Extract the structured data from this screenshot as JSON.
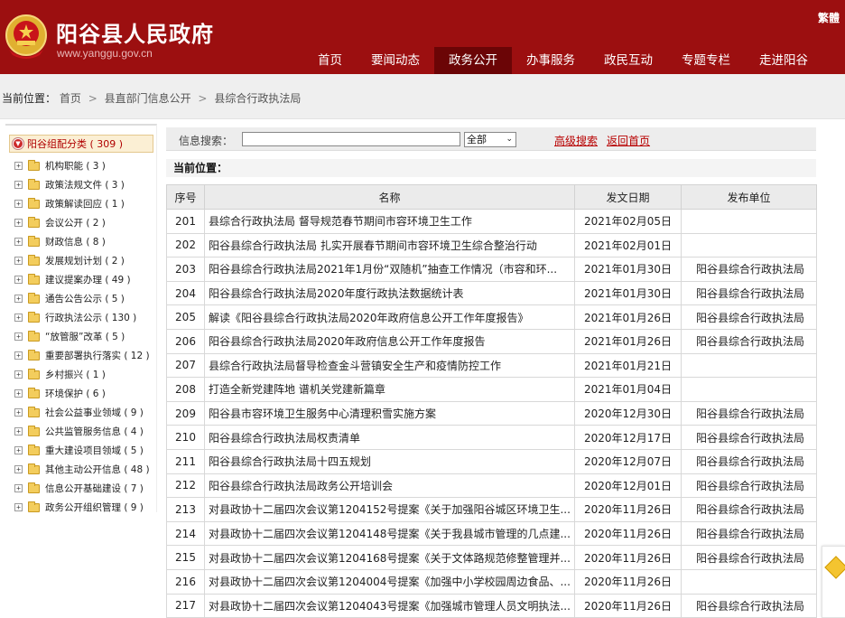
{
  "header": {
    "title": "阳谷县人民政府",
    "url": "www.yanggu.gov.cn",
    "trad_link": "繁體"
  },
  "nav": [
    {
      "label": "首页",
      "active": false
    },
    {
      "label": "要闻动态",
      "active": false
    },
    {
      "label": "政务公开",
      "active": true
    },
    {
      "label": "办事服务",
      "active": false
    },
    {
      "label": "政民互动",
      "active": false
    },
    {
      "label": "专题专栏",
      "active": false
    },
    {
      "label": "走进阳谷",
      "active": false
    }
  ],
  "breadcrumb": {
    "label": "当前位置：",
    "items": [
      "首页",
      "县直部门信息公开",
      "县综合行政执法局"
    ],
    "sep": ">"
  },
  "sidebar": {
    "root": "阳谷组配分类 ( 309 )",
    "items": [
      "机构职能 ( 3 )",
      "政策法规文件 ( 3 )",
      "政策解读回应 ( 1 )",
      "会议公开 ( 2 )",
      "财政信息 ( 8 )",
      "发展规划计划 ( 2 )",
      "建议提案办理 ( 49 )",
      "通告公告公示 ( 5 )",
      "行政执法公示 ( 130 )",
      "“放管服”改革 ( 5 )",
      "重要部署执行落实 ( 12 )",
      "乡村振兴 ( 1 )",
      "环境保护 ( 6 )",
      "社会公益事业领域 ( 9 )",
      "公共监管服务信息 ( 4 )",
      "重大建设项目领域 ( 5 )",
      "其他主动公开信息 ( 48 )",
      "信息公开基础建设 ( 7 )",
      "政务公开组织管理 ( 9 )"
    ]
  },
  "search": {
    "label": "信息搜索：",
    "value": "",
    "select_value": "全部",
    "advanced": "高级搜索",
    "back_home": "返回首页"
  },
  "current_position": "当前位置：",
  "table": {
    "headers": [
      "序号",
      "名称",
      "发文日期",
      "发布单位"
    ],
    "rows": [
      {
        "no": "201",
        "name": "县综合行政执法局 督导规范春节期间市容环境卫生工作",
        "date": "2021年02月05日",
        "unit": ""
      },
      {
        "no": "202",
        "name": "阳谷县综合行政执法局 扎实开展春节期间市容环境卫生综合整治行动",
        "date": "2021年02月01日",
        "unit": ""
      },
      {
        "no": "203",
        "name": "阳谷县综合行政执法局2021年1月份“双随机”抽查工作情况（市容和环...",
        "date": "2021年01月30日",
        "unit": "阳谷县综合行政执法局"
      },
      {
        "no": "204",
        "name": "阳谷县综合行政执法局2020年度行政执法数据统计表",
        "date": "2021年01月30日",
        "unit": "阳谷县综合行政执法局"
      },
      {
        "no": "205",
        "name": "解读《阳谷县综合行政执法局2020年政府信息公开工作年度报告》",
        "date": "2021年01月26日",
        "unit": "阳谷县综合行政执法局"
      },
      {
        "no": "206",
        "name": "阳谷县综合行政执法局2020年政府信息公开工作年度报告",
        "date": "2021年01月26日",
        "unit": "阳谷县综合行政执法局"
      },
      {
        "no": "207",
        "name": "县综合行政执法局督导检查金斗营镇安全生产和疫情防控工作",
        "date": "2021年01月21日",
        "unit": ""
      },
      {
        "no": "208",
        "name": "打造全新党建阵地 谱机关党建新篇章",
        "date": "2021年01月04日",
        "unit": ""
      },
      {
        "no": "209",
        "name": "阳谷县市容环境卫生服务中心清理积雪实施方案",
        "date": "2020年12月30日",
        "unit": "阳谷县综合行政执法局"
      },
      {
        "no": "210",
        "name": "阳谷县综合行政执法局权责清单",
        "date": "2020年12月17日",
        "unit": "阳谷县综合行政执法局"
      },
      {
        "no": "211",
        "name": "阳谷县综合行政执法局十四五规划",
        "date": "2020年12月07日",
        "unit": "阳谷县综合行政执法局"
      },
      {
        "no": "212",
        "name": "阳谷县综合行政执法局政务公开培训会",
        "date": "2020年12月01日",
        "unit": "阳谷县综合行政执法局"
      },
      {
        "no": "213",
        "name": "对县政协十二届四次会议第1204152号提案《关于加强阳谷城区环境卫生...",
        "date": "2020年11月26日",
        "unit": "阳谷县综合行政执法局"
      },
      {
        "no": "214",
        "name": "对县政协十二届四次会议第1204148号提案《关于我县城市管理的几点建...",
        "date": "2020年11月26日",
        "unit": "阳谷县综合行政执法局"
      },
      {
        "no": "215",
        "name": "对县政协十二届四次会议第1204168号提案《关于文体路规范修整管理并...",
        "date": "2020年11月26日",
        "unit": "阳谷县综合行政执法局"
      },
      {
        "no": "216",
        "name": "对县政协十二届四次会议第1204004号提案《加强中小学校园周边食品、...",
        "date": "2020年11月26日",
        "unit": ""
      },
      {
        "no": "217",
        "name": "对县政协十二届四次会议第1204043号提案《加强城市管理人员文明执法...",
        "date": "2020年11月26日",
        "unit": "阳谷县综合行政执法局"
      }
    ]
  },
  "colors": {
    "header_red": "#9c0f10",
    "nav_active": "#6b0506",
    "link_red": "#b80000"
  }
}
